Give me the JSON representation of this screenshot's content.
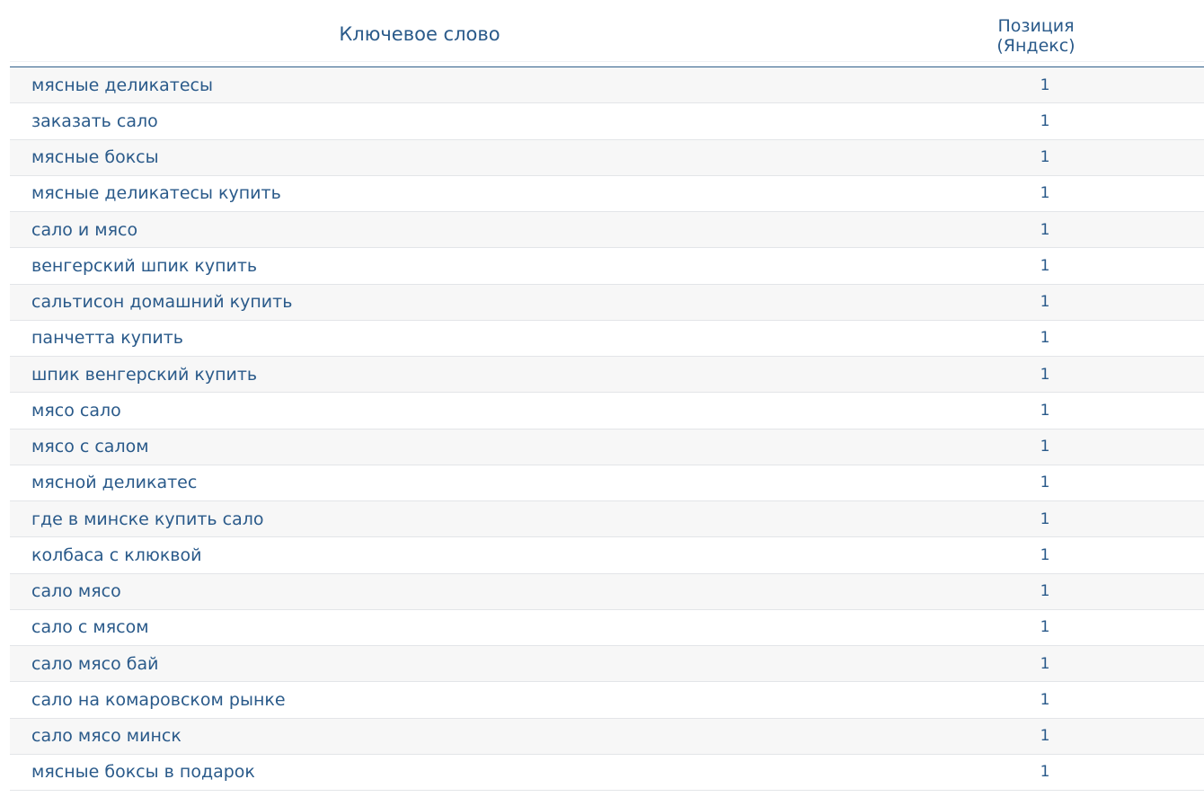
{
  "table": {
    "headers": {
      "keyword": "Ключевое слово",
      "position_line1": "Позиция",
      "position_line2": "(Яндекс)"
    },
    "rows": [
      {
        "keyword": "мясные деликатесы",
        "position": "1"
      },
      {
        "keyword": "заказать сало",
        "position": "1"
      },
      {
        "keyword": "мясные боксы",
        "position": "1"
      },
      {
        "keyword": "мясные деликатесы купить",
        "position": "1"
      },
      {
        "keyword": "сало и мясо",
        "position": "1"
      },
      {
        "keyword": "венгерский шпик купить",
        "position": "1"
      },
      {
        "keyword": "сальтисон домашний купить",
        "position": "1"
      },
      {
        "keyword": "панчетта купить",
        "position": "1"
      },
      {
        "keyword": "шпик венгерский купить",
        "position": "1"
      },
      {
        "keyword": "мясо сало",
        "position": "1"
      },
      {
        "keyword": "мясо с салом",
        "position": "1"
      },
      {
        "keyword": "мясной деликатес",
        "position": "1"
      },
      {
        "keyword": "где в минске купить сало",
        "position": "1"
      },
      {
        "keyword": "колбаса с клюквой",
        "position": "1"
      },
      {
        "keyword": "сало мясо",
        "position": "1"
      },
      {
        "keyword": "сало с мясом",
        "position": "1"
      },
      {
        "keyword": "сало мясо бай",
        "position": "1"
      },
      {
        "keyword": "сало на комаровском рынке",
        "position": "1"
      },
      {
        "keyword": "сало мясо минск",
        "position": "1"
      },
      {
        "keyword": "мясные боксы в подарок",
        "position": "1"
      }
    ]
  },
  "colors": {
    "text": "#2a5a8a",
    "header_border": "#2f5f8a",
    "row_stripe": "#f7f7f7",
    "row_border": "#e3e5e8"
  }
}
